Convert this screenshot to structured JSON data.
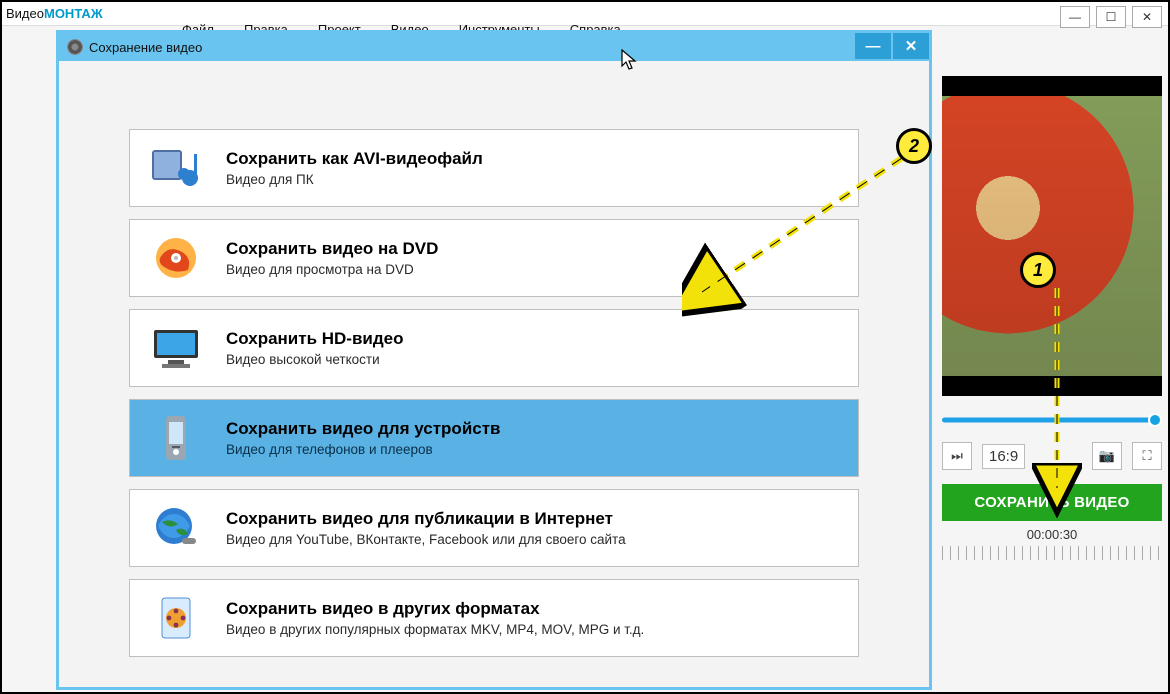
{
  "app": {
    "title_prefix": "Видео",
    "title_accent": "МОНТАЖ"
  },
  "menu": {
    "items": [
      "Файл",
      "Правка",
      "Проект",
      "Видео",
      "Инструменты",
      "Справка"
    ]
  },
  "window_controls": {
    "min": "—",
    "max": "☐",
    "close": "✕"
  },
  "preview": {
    "aspect": "16:9",
    "next_glyph": "⏭",
    "camera_glyph": "📷",
    "fullscreen_glyph": "⛶"
  },
  "save_button": {
    "label": "СОХРАНИТЬ ВИДЕО"
  },
  "timeline": {
    "time": "00:00:30"
  },
  "dialog": {
    "title": "Сохранение видео",
    "min": "—",
    "close": "✕",
    "options": [
      {
        "title": "Сохранить как AVI-видеофайл",
        "sub": "Видео для ПК",
        "selected": false,
        "icon": "avi"
      },
      {
        "title": "Сохранить видео на DVD",
        "sub": "Видео для просмотра на DVD",
        "selected": false,
        "icon": "dvd"
      },
      {
        "title": "Сохранить HD-видео",
        "sub": "Видео высокой четкости",
        "selected": false,
        "icon": "hd"
      },
      {
        "title": "Сохранить видео для устройств",
        "sub": "Видео для телефонов и плееров",
        "selected": true,
        "icon": "device"
      },
      {
        "title": "Сохранить видео для публикации в Интернет",
        "sub": "Видео для YouTube, ВКонтакте, Facebook или для своего сайта",
        "selected": false,
        "icon": "globe"
      },
      {
        "title": "Сохранить видео в других форматах",
        "sub": "Видео в других популярных форматах MKV, MP4, MOV, MPG и т.д.",
        "selected": false,
        "icon": "reel"
      }
    ]
  },
  "annot": {
    "badge1": "1",
    "badge2": "2"
  }
}
